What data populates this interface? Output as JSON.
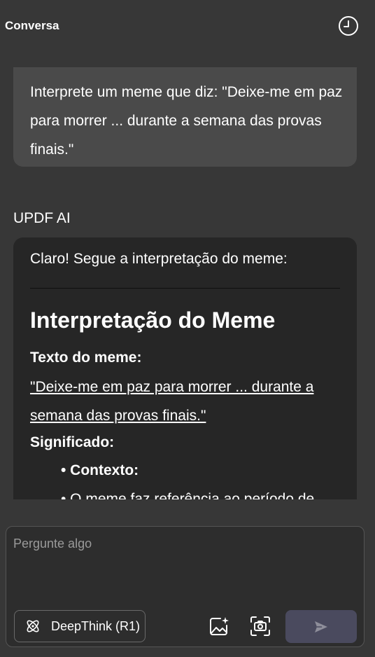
{
  "header": {
    "title": "Conversa",
    "history_icon": "clock-history-icon"
  },
  "chat": {
    "user_message": "Interprete um meme que diz: \"Deixe-me em paz para morrer ... durante a semana das provas finais.\"",
    "ai_sender": "UPDF AI",
    "ai_response": {
      "intro": "Claro! Segue a interpretação do meme:",
      "heading": "Interpretação do Meme",
      "meme_text_label": "Texto do meme:",
      "meme_quote": "\"Deixe-me em paz para morrer ... durante a semana das provas finais.\"",
      "meaning_label": "Significado:",
      "bullet_context": "• Contexto:",
      "bullet_partial": "• O meme faz referência ao período de"
    }
  },
  "composer": {
    "placeholder": "Pergunte algo",
    "value": "",
    "deepthink_label": "DeepThink (R1)",
    "icons": {
      "deepthink": "atom-icon",
      "image_ai": "image-sparkle-icon",
      "screenshot": "camera-capture-icon",
      "send": "send-icon"
    }
  },
  "colors": {
    "background": "#373737",
    "user_bubble": "#4a4a4a",
    "ai_bubble": "#262626",
    "composer_bg": "#2d2d2d",
    "send_button": "#4a4a5e",
    "text": "#ffffff",
    "placeholder": "#9a9a9a"
  }
}
